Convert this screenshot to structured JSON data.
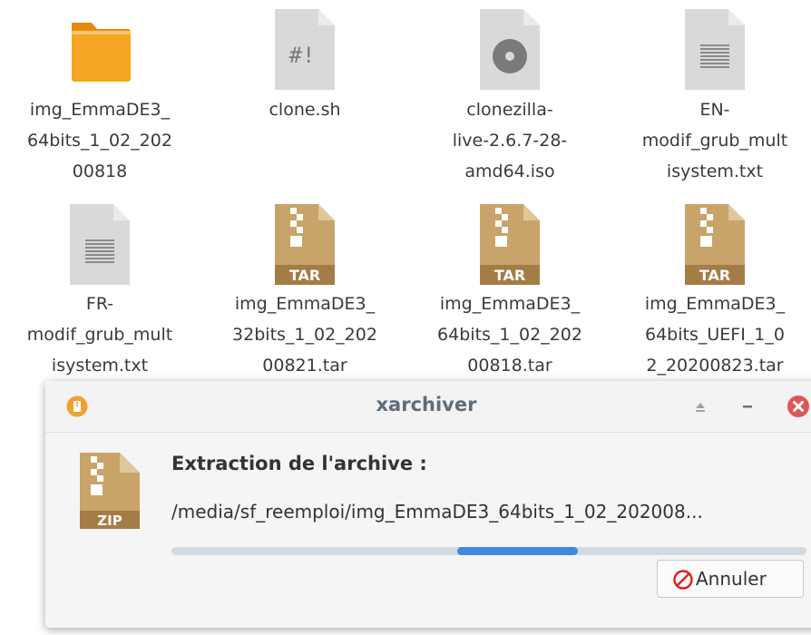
{
  "files": [
    {
      "icon": "folder-icon",
      "label": "img_EmmaDE3_\n64bits_1_02_202\n00818"
    },
    {
      "icon": "script-file-icon",
      "label": "clone.sh"
    },
    {
      "icon": "disc-image-icon",
      "label": "clonezilla-\nlive-2.6.7-28-\namd64.iso"
    },
    {
      "icon": "text-file-icon",
      "label": "EN-\nmodif_grub_mult\nisystem.txt"
    },
    {
      "icon": "text-file-icon",
      "label": "FR-\nmodif_grub_mult\nisystem.txt"
    },
    {
      "icon": "tar-archive-icon",
      "label": "img_EmmaDE3_\n32bits_1_02_202\n00821.tar"
    },
    {
      "icon": "tar-archive-icon",
      "label": "img_EmmaDE3_\n64bits_1_02_202\n00818.tar"
    },
    {
      "icon": "tar-archive-icon",
      "label": "img_EmmaDE3_\n64bits_UEFI_1_0\n2_20200823.tar"
    }
  ],
  "icon_texts": {
    "script": "#!",
    "tar": "TAR",
    "zip": "ZIP"
  },
  "dialog": {
    "title": "xarchiver",
    "heading": "Extraction de l'archive :",
    "path": "/media/sf_reemploi/img_EmmaDE3_64bits_1_02_202008...",
    "progress": {
      "start": 0.45,
      "end": 0.64
    },
    "cancel_label": "Annuler"
  },
  "colors": {
    "folder": "#f5a623",
    "archive": "#c8a36a",
    "archive_label_bg": "#a47c45",
    "progress_fill": "#3f8ae0",
    "progress_track": "#d2d9e1",
    "title_text": "#5f6d7a",
    "close_button": "#e05555",
    "cancel_icon": "#e02020"
  }
}
